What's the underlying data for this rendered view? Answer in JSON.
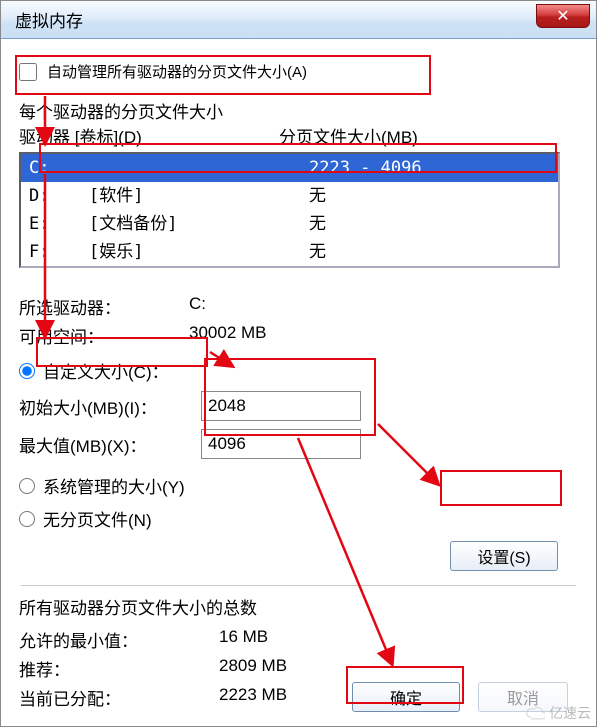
{
  "window": {
    "title": "虚拟内存",
    "close_glyph": "✕"
  },
  "auto_manage": {
    "label": "自动管理所有驱动器的分页文件大小(A)",
    "checked": false
  },
  "drive_section": {
    "heading": "每个驱动器的分页文件大小",
    "col_drive": "驱动器  [卷标](D)",
    "col_size": "分页文件大小(MB)"
  },
  "drives": [
    {
      "letter": "C:",
      "label": "",
      "size": "2223 - 4096",
      "selected": true
    },
    {
      "letter": "D:",
      "label": "[软件]",
      "size": "无",
      "selected": false
    },
    {
      "letter": "E:",
      "label": "[文档备份]",
      "size": "无",
      "selected": false
    },
    {
      "letter": "F:",
      "label": "[娱乐]",
      "size": "无",
      "selected": false
    }
  ],
  "selected_drive": {
    "label": "所选驱动器：",
    "value": "C:"
  },
  "free_space": {
    "label": "可用空间：",
    "value": "30002 MB"
  },
  "size_options": {
    "custom": {
      "label": "自定义大小(C)：",
      "selected": true
    },
    "system": {
      "label": "系统管理的大小(Y)",
      "selected": false
    },
    "none": {
      "label": "无分页文件(N)",
      "selected": false
    }
  },
  "initial_size": {
    "label": "初始大小(MB)(I)：",
    "value": "2048"
  },
  "max_size": {
    "label": "最大值(MB)(X)：",
    "value": "4096"
  },
  "set_button": "设置(S)",
  "totals": {
    "heading": "所有驱动器分页文件大小的总数",
    "min_allowed": {
      "label": "允许的最小值：",
      "value": "16 MB"
    },
    "recommended": {
      "label": "推荐：",
      "value": "2809 MB"
    },
    "current": {
      "label": "当前已分配：",
      "value": "2223 MB"
    }
  },
  "footer": {
    "ok": "确定",
    "cancel": "取消"
  },
  "watermark": "亿速云"
}
